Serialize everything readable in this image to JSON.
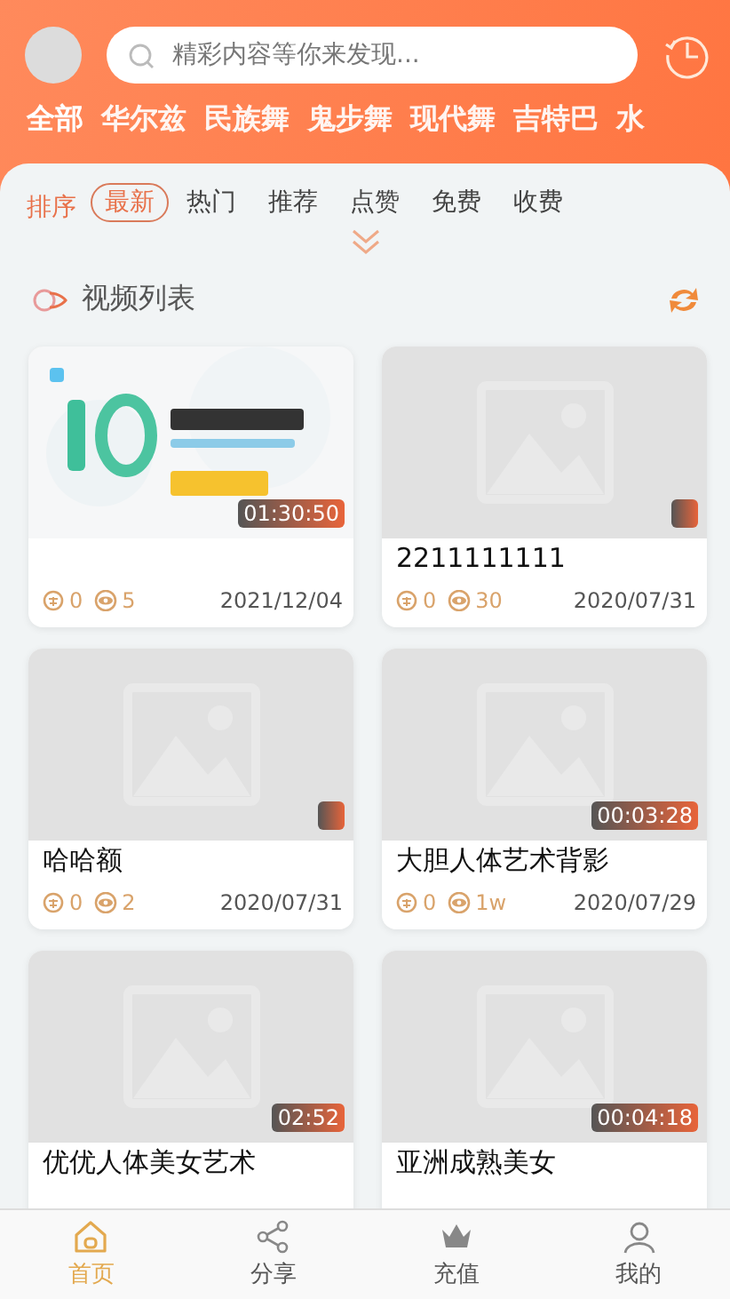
{
  "search": {
    "placeholder": "精彩内容等你来发现..."
  },
  "categories": [
    {
      "label": "全部",
      "selected": true
    },
    {
      "label": "华尔兹",
      "selected": false
    },
    {
      "label": "民族舞",
      "selected": false
    },
    {
      "label": "鬼步舞",
      "selected": false
    },
    {
      "label": "现代舞",
      "selected": false
    },
    {
      "label": "吉特巴",
      "selected": false
    },
    {
      "label": "水",
      "selected": false
    }
  ],
  "sort": {
    "label": "排序",
    "options": [
      {
        "label": "最新",
        "selected": true
      },
      {
        "label": "热门",
        "selected": false
      },
      {
        "label": "推荐",
        "selected": false
      },
      {
        "label": "点赞",
        "selected": false
      },
      {
        "label": "免费",
        "selected": false
      },
      {
        "label": "收费",
        "selected": false
      }
    ]
  },
  "section": {
    "title": "视频列表"
  },
  "video_rows": [
    {
      "videos": [
        {
          "kind": "picture",
          "badge": true,
          "duration": "01:30:50",
          "coins": "0",
          "views": "5",
          "date": "2021/12/04"
        },
        {
          "kind": "placeholder",
          "badge": true,
          "title": "2211111111",
          "coins": "0",
          "views": "30",
          "date": "2020/07/31"
        }
      ]
    },
    {
      "videos": [
        {
          "kind": "placeholder",
          "badge": true,
          "title": "哈哈额",
          "coins": "0",
          "views": "2",
          "date": "2020/07/31"
        },
        {
          "kind": "placeholder",
          "badge": true,
          "duration": "00:03:28",
          "title": "大胆人体艺术背影",
          "coins": "0",
          "views": "1w",
          "date": "2020/07/29"
        }
      ]
    },
    {
      "videos": [
        {
          "kind": "placeholder",
          "badge": true,
          "duration": "02:52",
          "title": "优优人体美女艺术"
        },
        {
          "kind": "placeholder",
          "badge": true,
          "duration": "00:04:18",
          "title": "亚洲成熟美女"
        }
      ]
    }
  ],
  "tabbar": [
    {
      "kind": "home",
      "label": "首页",
      "selected": true
    },
    {
      "kind": "share",
      "label": "分享",
      "selected": false
    },
    {
      "kind": "vip",
      "label": "充值",
      "selected": false
    },
    {
      "kind": "user",
      "label": "我的",
      "selected": false
    }
  ]
}
